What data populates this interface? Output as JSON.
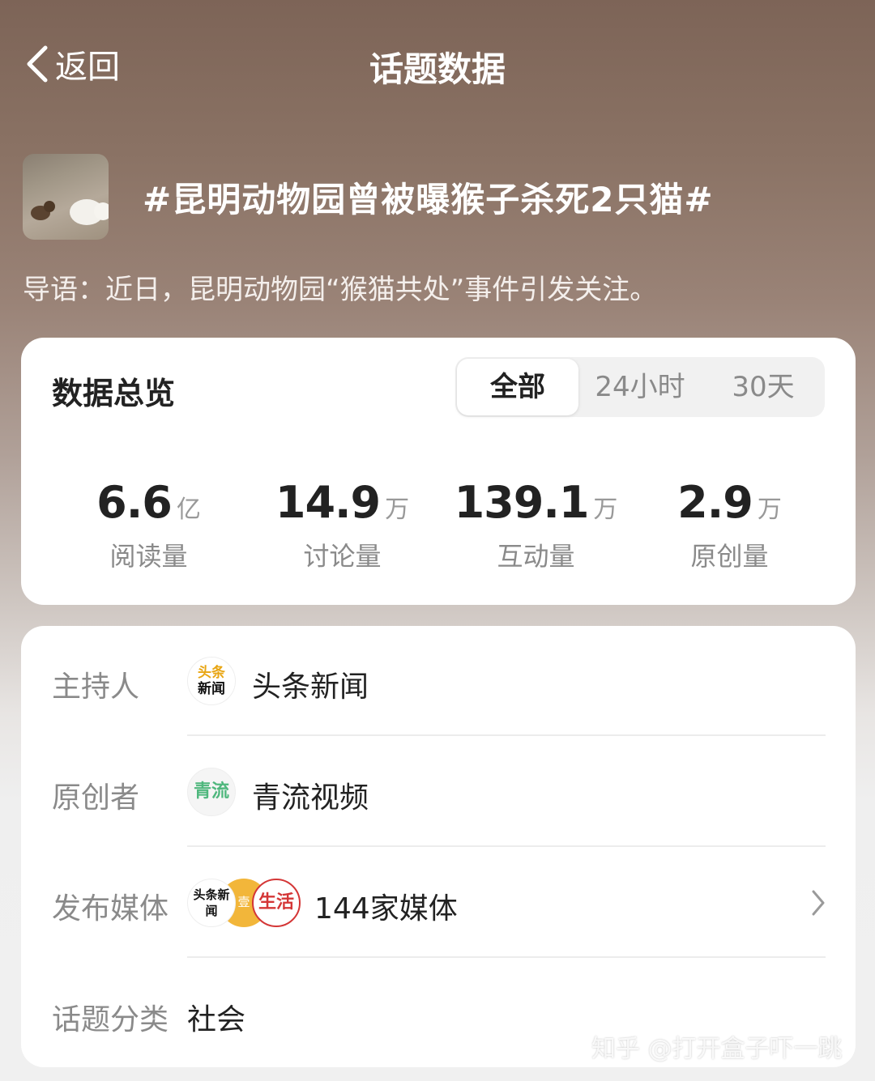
{
  "nav": {
    "back_label": "返回",
    "title": "话题数据"
  },
  "topic": {
    "title": "#昆明动物园曾被曝猴子杀死2只猫#",
    "intro": "导语：近日，昆明动物园“猴猫共处”事件引发关注。"
  },
  "overview": {
    "title": "数据总览",
    "tabs": [
      {
        "label": "全部",
        "active": true
      },
      {
        "label": "24小时",
        "active": false
      },
      {
        "label": "30天",
        "active": false
      }
    ],
    "stats": [
      {
        "value": "6.6",
        "unit": "亿",
        "label": "阅读量"
      },
      {
        "value": "14.9",
        "unit": "万",
        "label": "讨论量"
      },
      {
        "value": "139.1",
        "unit": "万",
        "label": "互动量"
      },
      {
        "value": "2.9",
        "unit": "万",
        "label": "原创量"
      }
    ]
  },
  "info": {
    "host_label": "主持人",
    "host_name": "头条新闻",
    "host_avatar": {
      "top": "头条",
      "bottom": "新闻"
    },
    "creator_label": "原创者",
    "creator_name": "青流视频",
    "creator_avatar": "青流",
    "media_label": "发布媒体",
    "media_value": "144家媒体",
    "media_avatars": [
      "头条新闻",
      "壹",
      "生活"
    ],
    "category_label": "话题分类",
    "category_value": "社会"
  },
  "watermark": "知乎 @打开盒子吓一跳",
  "colors": {
    "accent_gold": "#e8a512",
    "media_red": "#d43636",
    "green": "#4fb77d"
  }
}
